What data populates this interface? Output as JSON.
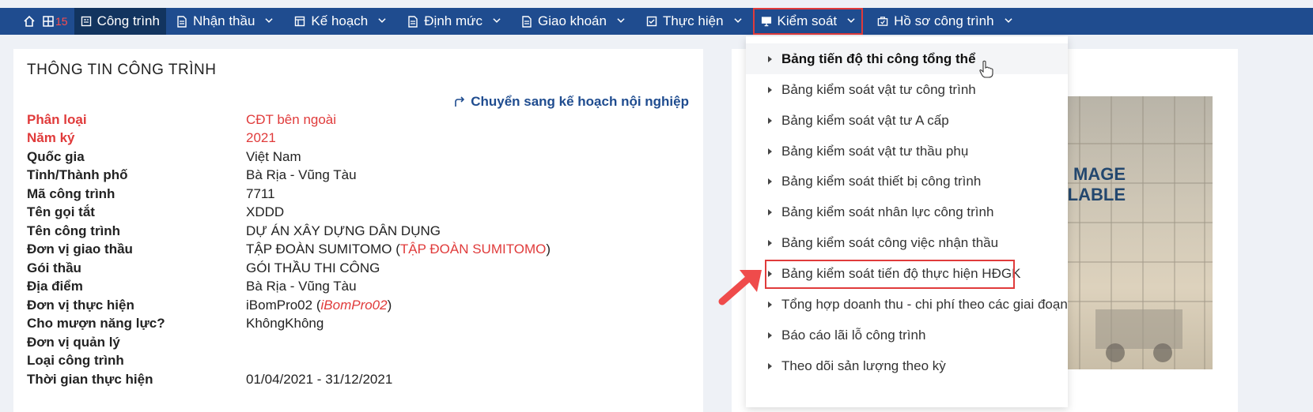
{
  "nav": {
    "home_icon": "home-icon",
    "grid_icon": "grid-icon",
    "badge": "15",
    "items": [
      {
        "label": "Công trình",
        "icon": "building-icon",
        "active": true,
        "dropdown": false
      },
      {
        "label": "Nhận thầu",
        "icon": "document-icon",
        "dropdown": true
      },
      {
        "label": "Kế hoạch",
        "icon": "plan-icon",
        "dropdown": true
      },
      {
        "label": "Định mức",
        "icon": "document-icon",
        "dropdown": true
      },
      {
        "label": "Giao khoán",
        "icon": "document-icon",
        "dropdown": true
      },
      {
        "label": "Thực hiện",
        "icon": "checklist-icon",
        "dropdown": true
      },
      {
        "label": "Kiểm soát",
        "icon": "monitor-icon",
        "dropdown": true,
        "highlight": true
      },
      {
        "label": "Hồ sơ công trình",
        "icon": "briefcase-icon",
        "dropdown": true
      }
    ]
  },
  "card": {
    "title": "THÔNG TIN CÔNG TRÌNH",
    "convert_link": "Chuyển sang kế hoạch nội nghiệp",
    "rows": [
      {
        "label": "Phân loại",
        "value": "CĐT bên ngoài",
        "red": true
      },
      {
        "label": "Năm ký",
        "value": "2021",
        "red": true
      },
      {
        "label": "Quốc gia",
        "value": "Việt Nam"
      },
      {
        "label": "Tỉnh/Thành phố",
        "value": "Bà Rịa - Vũng Tàu"
      },
      {
        "label": "Mã công trình",
        "value": "7711"
      },
      {
        "label": "Tên gọi tắt",
        "value": "XDDD"
      },
      {
        "label": "Tên công trình",
        "value": "DỰ ÁN XÂY DỰNG DÂN DỤNG"
      },
      {
        "label": "Đơn vị giao thầu",
        "value": "TẬP ĐOÀN SUMITOMO",
        "extra": "TẬP ĐOÀN SUMITOMO",
        "extra_style": "red"
      },
      {
        "label": "Gói thầu",
        "value": "GÓI THẦU THI CÔNG"
      },
      {
        "label": "Địa điểm",
        "value": "Bà Rịa - Vũng Tàu"
      },
      {
        "label": "Đơn vị thực hiện",
        "value": "iBomPro02",
        "extra": "iBomPro02",
        "extra_style": "red-italic"
      },
      {
        "label": "Cho mượn năng lực?",
        "value": "KhôngKhông"
      },
      {
        "label": "Đơn vị quản lý",
        "value": ""
      },
      {
        "label": "Loại công trình",
        "value": ""
      },
      {
        "label": "Thời gian thực hiện",
        "value": "01/04/2021 - 31/12/2021"
      }
    ]
  },
  "image_placeholder": {
    "line1": "MAGE",
    "line2": "LABLE"
  },
  "dropdown": {
    "items": [
      {
        "label": "Bảng tiến độ thi công tổng thể",
        "hover": true
      },
      {
        "label": "Bảng kiểm soát vật tư công trình"
      },
      {
        "label": "Bảng kiểm soát vật tư A cấp"
      },
      {
        "label": "Bảng kiểm soát vật tư thầu phụ"
      },
      {
        "label": "Bảng kiểm soát thiết bị công trình"
      },
      {
        "label": "Bảng kiểm soát nhân lực công trình"
      },
      {
        "label": "Bảng kiểm soát công việc nhận thầu"
      },
      {
        "label": "Bảng kiểm soát tiến độ thực hiện HĐGK",
        "boxed": true
      },
      {
        "label": "Tổng hợp doanh thu - chi phí theo các giai đoạn"
      },
      {
        "label": "Báo cáo lãi lỗ công trình"
      },
      {
        "label": "Theo dõi sản lượng theo kỳ"
      }
    ]
  },
  "colors": {
    "nav_bg": "#1f4c8f",
    "accent_red": "#e03b3b"
  }
}
